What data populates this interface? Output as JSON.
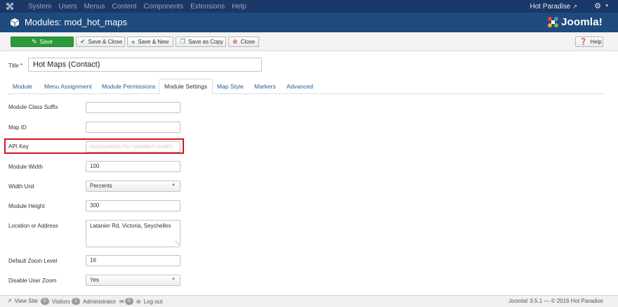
{
  "topnav": {
    "menu": [
      "System",
      "Users",
      "Menus",
      "Content",
      "Components",
      "Extensions",
      "Help"
    ],
    "site_name": "Hot Paradise"
  },
  "header": {
    "title": "Modules: mod_hot_maps",
    "brand": "Joomla!"
  },
  "toolbar": {
    "save": "Save",
    "save_close": "Save & Close",
    "save_new": "Save & New",
    "save_copy": "Save as Copy",
    "close": "Close",
    "help": "Help"
  },
  "form": {
    "title_label": "Title *",
    "title_value": "Hot Maps (Contact)"
  },
  "tabs": [
    "Module",
    "Menu Assignment",
    "Module Permissions",
    "Module Settings",
    "Map Style",
    "Markers",
    "Advanced"
  ],
  "fields": {
    "class_suffix": {
      "label": "Module Class Suffix",
      "value": ""
    },
    "map_id": {
      "label": "Map ID",
      "value": ""
    },
    "api_key": {
      "label": "API Key",
      "value": "AIzaSyAWGLPN-YyHHMvTn4w8P1"
    },
    "module_width": {
      "label": "Module Width",
      "value": "100"
    },
    "width_unit": {
      "label": "Width Unit",
      "value": "Percents"
    },
    "module_height": {
      "label": "Module Height",
      "value": "300"
    },
    "location": {
      "label": "Location or Address",
      "value": "Latanier Rd, Victoria, Seychelles"
    },
    "zoom": {
      "label": "Default Zoom Level",
      "value": "16"
    },
    "disable_zoom": {
      "label": "Disable User Zoom",
      "value": "Yes"
    }
  },
  "statusbar": {
    "view_site": "View Site",
    "visitors_count": "0",
    "visitors": "Visitors",
    "admin_count": "1",
    "administrator": "Administrator",
    "mail_count": "0",
    "logout": "Log out",
    "footer": "Joomla! 3.5.1  —  © 2016 Hot Paradise"
  },
  "colors": {
    "nav_bg": "#1a3867",
    "title_bg": "#1f4a7d",
    "save_green": "#2d9a3b",
    "highlight_red": "#d2161b",
    "link_blue": "#1f5d9a"
  }
}
